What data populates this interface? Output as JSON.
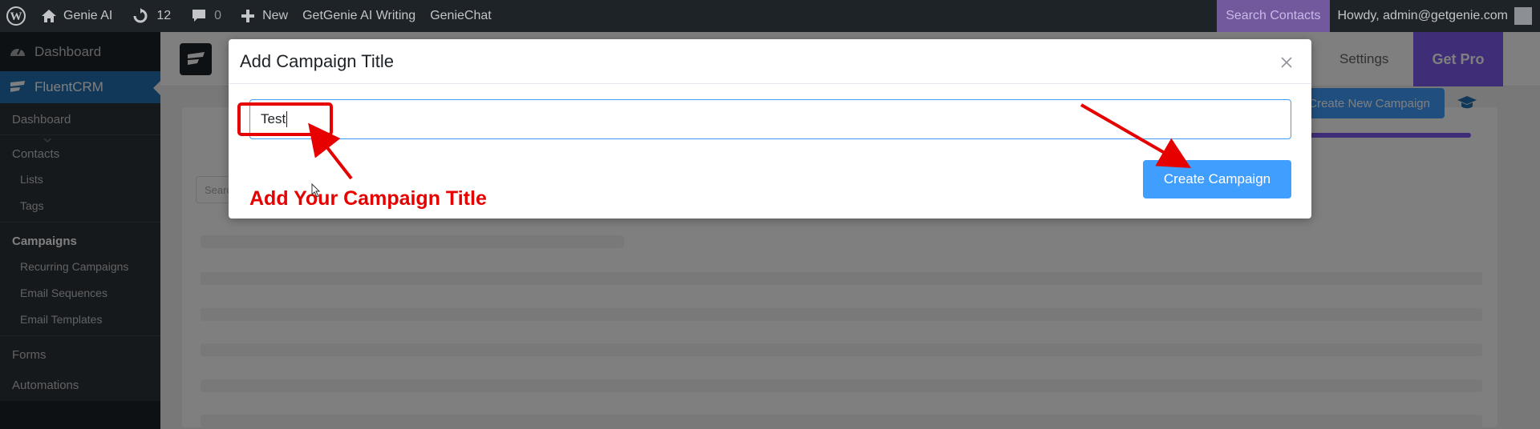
{
  "admin_bar": {
    "site_name": "Genie AI",
    "updates_count": "12",
    "comments_count": "0",
    "new_label": "New",
    "getgenie_label": "GetGenie AI Writing",
    "geniechat_label": "GenieChat",
    "search_contacts_label": "Search Contacts",
    "howdy_label": "Howdy, admin@getgenie.com"
  },
  "sidebar": {
    "dashboard_label": "Dashboard",
    "fluentcrm_label": "FluentCRM",
    "items": [
      {
        "label": "Dashboard"
      },
      {
        "label": "Contacts"
      },
      {
        "label": "Lists"
      },
      {
        "label": "Tags"
      },
      {
        "label": "Campaigns"
      },
      {
        "label": "Recurring Campaigns"
      },
      {
        "label": "Email Sequences"
      },
      {
        "label": "Email Templates"
      },
      {
        "label": "Forms"
      },
      {
        "label": "Automations"
      }
    ]
  },
  "header": {
    "settings_label": "Settings",
    "getpro_label": "Get Pro"
  },
  "page": {
    "create_new_label": "Create New Campaign",
    "search_placeholder": "Search"
  },
  "modal": {
    "title": "Add Campaign Title",
    "input_value": "Test",
    "create_button_label": "Create Campaign"
  },
  "annotation": {
    "text": "Add Your Campaign Title",
    "color": "#e60000"
  },
  "colors": {
    "admin_bar": "#1d2327",
    "primary": "#409eff",
    "wp_blue": "#2271b1",
    "pro_purple": "#7e5bef"
  }
}
